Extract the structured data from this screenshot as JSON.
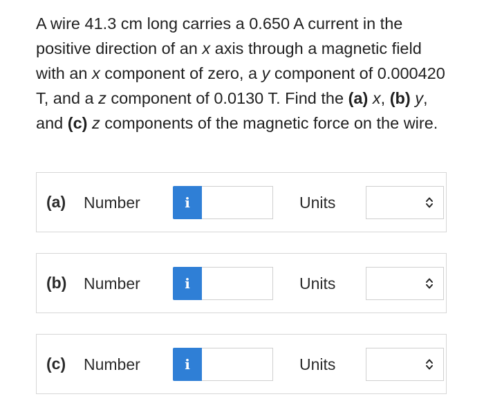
{
  "question": {
    "seg1": "A wire 41.3 cm long carries a 0.650 A current in the positive direction of an ",
    "x1": "x",
    "seg2": " axis through a magnetic field with an ",
    "x2": "x",
    "seg3": " component of zero, a ",
    "y1": "y",
    "seg4": " component of 0.000420 T, and a ",
    "z1": "z",
    "seg5": " component of 0.0130 T. Find the ",
    "pa": "(a)",
    "x3": " x",
    "seg6": ", ",
    "pb": "(b)",
    "y2": " y",
    "seg7": ", and ",
    "pc": "(c)",
    "z2": " z",
    "seg8": " components of the magnetic force on the wire."
  },
  "answers": [
    {
      "part": "(a)",
      "number_label": "Number",
      "info_glyph": "i",
      "number_value": "",
      "units_label": "Units",
      "units_value": ""
    },
    {
      "part": "(b)",
      "number_label": "Number",
      "info_glyph": "i",
      "number_value": "",
      "units_label": "Units",
      "units_value": ""
    },
    {
      "part": "(c)",
      "number_label": "Number",
      "info_glyph": "i",
      "number_value": "",
      "units_label": "Units",
      "units_value": ""
    }
  ],
  "colors": {
    "info_button": "#2f7fd6",
    "border": "#d6d6d6"
  },
  "icons": {
    "info": "info-icon",
    "select": "chevron-up-down-icon"
  }
}
